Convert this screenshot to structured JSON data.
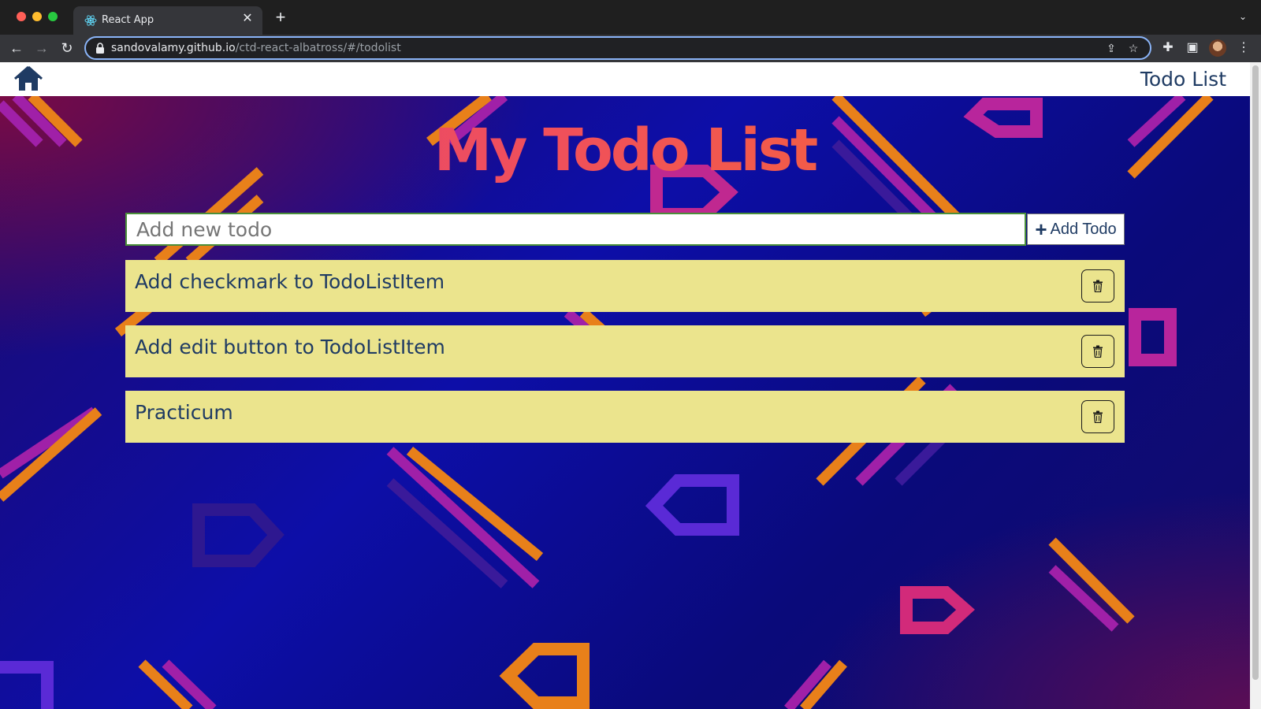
{
  "browser": {
    "tab_title": "React App",
    "url_host": "sandovalamy.github.io",
    "url_path": "/ctd-react-albatross/#/todolist"
  },
  "navbar": {
    "link_label": "Todo List"
  },
  "main": {
    "title": "My Todo List",
    "input_placeholder": "Add new todo",
    "input_value": "",
    "add_button_icon": "+",
    "add_button_label": "Add Todo"
  },
  "todos": [
    {
      "text": "Add checkmark to TodoListItem"
    },
    {
      "text": "Add edit button to TodoListItem"
    },
    {
      "text": "Practicum"
    }
  ],
  "colors": {
    "todo_item_bg": "#ebe48d",
    "text_navy": "#1f3b63",
    "title_gradient_start": "#e0407a",
    "title_gradient_end": "#f5702a"
  }
}
